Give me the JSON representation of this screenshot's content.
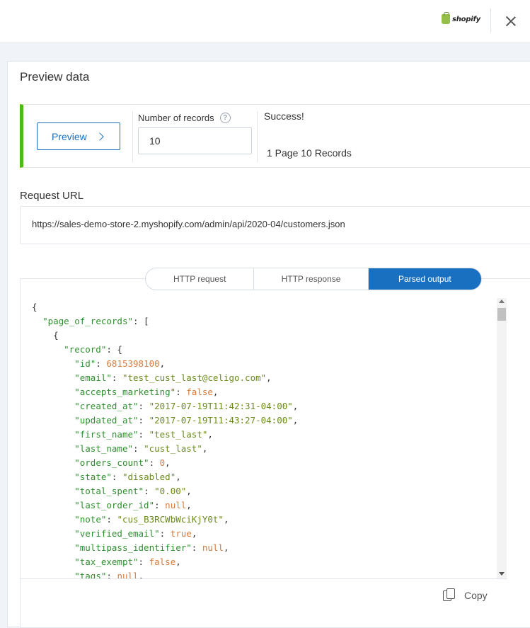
{
  "topbar": {
    "logo_text": "shopify",
    "logo_icon": "shopify-bag-icon",
    "close_icon": "close-icon"
  },
  "panel": {
    "title": "Preview data",
    "preview_button": "Preview",
    "records_label": "Number of records",
    "records_value": "10",
    "status": "Success!",
    "records_summary": "1 Page 10 Records",
    "status_color": "#4cbb17"
  },
  "request": {
    "label": "Request URL",
    "url": "https://sales-demo-store-2.myshopify.com/admin/api/2020-04/customers.json"
  },
  "tabs": [
    {
      "label": "HTTP request",
      "active": false
    },
    {
      "label": "HTTP response",
      "active": false
    },
    {
      "label": "Parsed output",
      "active": true
    }
  ],
  "accent": "#1a70c0",
  "code_lines": [
    [
      [
        "p",
        "{"
      ]
    ],
    [
      [
        "p",
        "  "
      ],
      [
        "k",
        "\"page_of_records\""
      ],
      [
        "p",
        ": ["
      ]
    ],
    [
      [
        "p",
        "    {"
      ]
    ],
    [
      [
        "p",
        "      "
      ],
      [
        "k",
        "\"record\""
      ],
      [
        "p",
        ": {"
      ]
    ],
    [
      [
        "p",
        "        "
      ],
      [
        "k",
        "\"id\""
      ],
      [
        "p",
        ": "
      ],
      [
        "n",
        "6815398100"
      ],
      [
        "p",
        ","
      ]
    ],
    [
      [
        "p",
        "        "
      ],
      [
        "k",
        "\"email\""
      ],
      [
        "p",
        ": "
      ],
      [
        "s",
        "\"test_cust_last@celigo.com\""
      ],
      [
        "p",
        ","
      ]
    ],
    [
      [
        "p",
        "        "
      ],
      [
        "k",
        "\"accepts_marketing\""
      ],
      [
        "p",
        ": "
      ],
      [
        "n",
        "false"
      ],
      [
        "p",
        ","
      ]
    ],
    [
      [
        "p",
        "        "
      ],
      [
        "k",
        "\"created_at\""
      ],
      [
        "p",
        ": "
      ],
      [
        "s",
        "\"2017-07-19T11:42:31-04:00\""
      ],
      [
        "p",
        ","
      ]
    ],
    [
      [
        "p",
        "        "
      ],
      [
        "k",
        "\"updated_at\""
      ],
      [
        "p",
        ": "
      ],
      [
        "s",
        "\"2017-07-19T11:43:27-04:00\""
      ],
      [
        "p",
        ","
      ]
    ],
    [
      [
        "p",
        "        "
      ],
      [
        "k",
        "\"first_name\""
      ],
      [
        "p",
        ": "
      ],
      [
        "s",
        "\"test_last\""
      ],
      [
        "p",
        ","
      ]
    ],
    [
      [
        "p",
        "        "
      ],
      [
        "k",
        "\"last_name\""
      ],
      [
        "p",
        ": "
      ],
      [
        "s",
        "\"cust_last\""
      ],
      [
        "p",
        ","
      ]
    ],
    [
      [
        "p",
        "        "
      ],
      [
        "k",
        "\"orders_count\""
      ],
      [
        "p",
        ": "
      ],
      [
        "n",
        "0"
      ],
      [
        "p",
        ","
      ]
    ],
    [
      [
        "p",
        "        "
      ],
      [
        "k",
        "\"state\""
      ],
      [
        "p",
        ": "
      ],
      [
        "s",
        "\"disabled\""
      ],
      [
        "p",
        ","
      ]
    ],
    [
      [
        "p",
        "        "
      ],
      [
        "k",
        "\"total_spent\""
      ],
      [
        "p",
        ": "
      ],
      [
        "s",
        "\"0.00\""
      ],
      [
        "p",
        ","
      ]
    ],
    [
      [
        "p",
        "        "
      ],
      [
        "k",
        "\"last_order_id\""
      ],
      [
        "p",
        ": "
      ],
      [
        "n",
        "null"
      ],
      [
        "p",
        ","
      ]
    ],
    [
      [
        "p",
        "        "
      ],
      [
        "k",
        "\"note\""
      ],
      [
        "p",
        ": "
      ],
      [
        "s",
        "\"cus_B3RCWbWciKjY0t\""
      ],
      [
        "p",
        ","
      ]
    ],
    [
      [
        "p",
        "        "
      ],
      [
        "k",
        "\"verified_email\""
      ],
      [
        "p",
        ": "
      ],
      [
        "n",
        "true"
      ],
      [
        "p",
        ","
      ]
    ],
    [
      [
        "p",
        "        "
      ],
      [
        "k",
        "\"multipass_identifier\""
      ],
      [
        "p",
        ": "
      ],
      [
        "n",
        "null"
      ],
      [
        "p",
        ","
      ]
    ],
    [
      [
        "p",
        "        "
      ],
      [
        "k",
        "\"tax_exempt\""
      ],
      [
        "p",
        ": "
      ],
      [
        "n",
        "false"
      ],
      [
        "p",
        ","
      ]
    ],
    [
      [
        "p",
        "        "
      ],
      [
        "k",
        "\"tags\""
      ],
      [
        "p",
        ": "
      ],
      [
        "n",
        "null"
      ],
      [
        "p",
        ","
      ]
    ]
  ],
  "copy_label": "Copy"
}
